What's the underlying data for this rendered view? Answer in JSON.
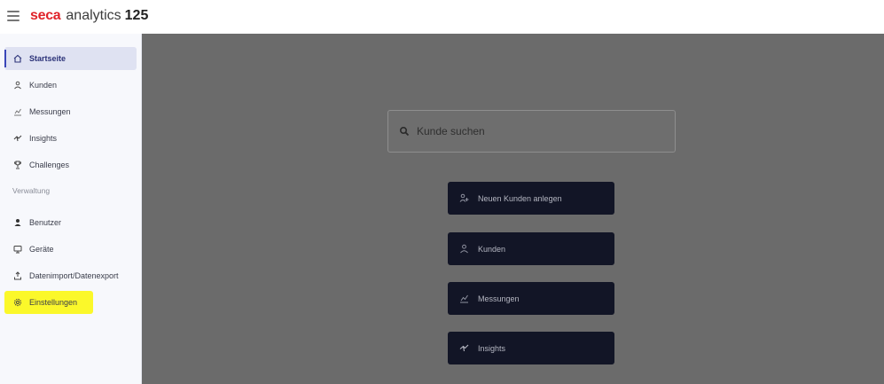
{
  "header": {
    "logo": "seca",
    "product": "analytics",
    "version": "125"
  },
  "sidebar": {
    "items": [
      {
        "label": "Startseite",
        "icon": "home-icon"
      },
      {
        "label": "Kunden",
        "icon": "customers-icon"
      },
      {
        "label": "Messungen",
        "icon": "measurements-icon"
      },
      {
        "label": "Insights",
        "icon": "insights-icon"
      },
      {
        "label": "Challenges",
        "icon": "trophy-icon"
      }
    ],
    "section_label": "Verwaltung",
    "admin_items": [
      {
        "label": "Benutzer",
        "icon": "user-icon"
      },
      {
        "label": "Geräte",
        "icon": "devices-icon"
      },
      {
        "label": "Datenimport/Datenexport",
        "icon": "import-export-icon"
      },
      {
        "label": "Einstellungen",
        "icon": "settings-icon"
      }
    ]
  },
  "main": {
    "search_placeholder": "Kunde suchen",
    "buttons": [
      {
        "label": "Neuen Kunden anlegen",
        "icon": "add-customer-icon"
      },
      {
        "label": "Kunden",
        "icon": "customers-icon"
      },
      {
        "label": "Messungen",
        "icon": "measurements-icon"
      },
      {
        "label": "Insights",
        "icon": "insights-icon"
      }
    ]
  },
  "colors": {
    "brand": "#e0242b",
    "highlight": "#fbf82a",
    "overlay": "#6b6b6b",
    "button_bg": "#121526"
  }
}
